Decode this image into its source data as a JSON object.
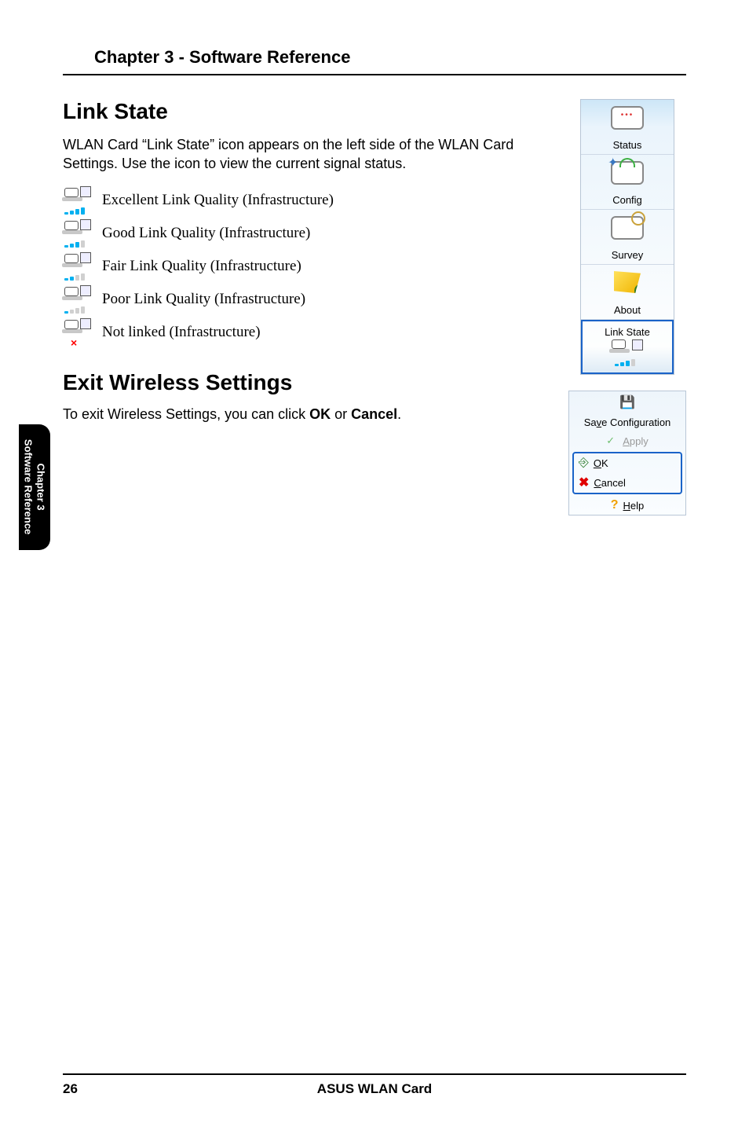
{
  "chapter_header": "Chapter 3 - Software Reference",
  "link_state": {
    "title": "Link State",
    "intro": "WLAN Card “Link State” icon appears on the left side of the WLAN Card Settings. Use the icon to view the current signal status.",
    "items": [
      {
        "label": "Excellent Link Quality (Infrastructure)",
        "bars_on": 4,
        "crossed": false
      },
      {
        "label": "Good Link Quality (Infrastructure)",
        "bars_on": 3,
        "crossed": false
      },
      {
        "label": "Fair Link Quality (Infrastructure)",
        "bars_on": 2,
        "crossed": false
      },
      {
        "label": "Poor Link Quality (Infrastructure)",
        "bars_on": 1,
        "crossed": false
      },
      {
        "label": "Not linked (Infrastructure)",
        "bars_on": 0,
        "crossed": true
      }
    ]
  },
  "exit": {
    "title": "Exit Wireless Settings",
    "body_pre": "To exit Wireless Settings, you can click ",
    "ok": "OK",
    "mid": " or ",
    "cancel": "Cancel",
    "post": "."
  },
  "side_panel": {
    "items": [
      {
        "label": "Status",
        "icon": "dots"
      },
      {
        "label": "Config",
        "icon": "gear"
      },
      {
        "label": "Survey",
        "icon": "lens"
      },
      {
        "label": "About",
        "icon": "flag"
      },
      {
        "label": "Link State",
        "icon": "link",
        "highlight": true
      }
    ]
  },
  "action_panel": {
    "save_label": "Save Configuration",
    "apply_label": "Apply",
    "ok_label": "OK",
    "cancel_label": "Cancel",
    "help_label": "Help"
  },
  "side_tab": {
    "line1": "Chapter 3",
    "line2": "Software Reference"
  },
  "footer": {
    "page": "26",
    "product": "ASUS WLAN Card"
  }
}
